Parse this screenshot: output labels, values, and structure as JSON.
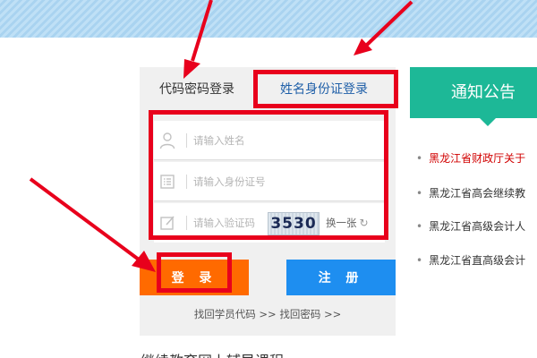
{
  "login": {
    "tabs": [
      {
        "label": "代码密码登录"
      },
      {
        "label": "姓名身份证登录"
      }
    ],
    "fields": {
      "name_placeholder": "请输入姓名",
      "id_placeholder": "请输入身份证号",
      "captcha_placeholder": "请输入验证码"
    },
    "captcha_code": "3530",
    "refresh_label": "换一张",
    "login_button": "登 录",
    "register_button": "注 册",
    "recover_links": {
      "code": "找回学员代码 >>",
      "password": "找回密码 >>"
    }
  },
  "notice": {
    "title": "通知公告",
    "items": [
      {
        "text": "黑龙江省财政厅关于",
        "highlight": true
      },
      {
        "text": "黑龙江省高会继续教"
      },
      {
        "text": "黑龙江省高级会计人"
      },
      {
        "text": "黑龙江省直高级会计"
      }
    ]
  },
  "section_title": "继续教育网上辅导课程",
  "colors": {
    "accent_orange": "#ff6a00",
    "accent_blue": "#1e8ef0",
    "notice_green": "#1db897",
    "annotation_red": "#e8001c",
    "notice_highlight_red": "#d10000"
  }
}
